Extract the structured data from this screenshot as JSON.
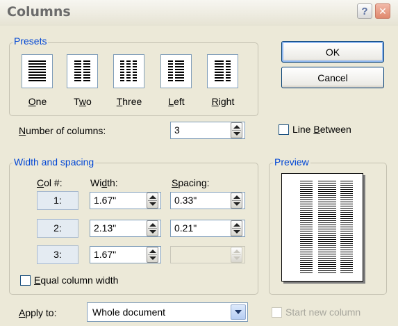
{
  "window": {
    "title": "Columns",
    "help_glyph": "?",
    "close_glyph": "✕"
  },
  "presets": {
    "legend": "Presets",
    "items": [
      {
        "label": "One",
        "key": "O",
        "rest": "ne",
        "icon": "one-column-icon"
      },
      {
        "label": "Two",
        "key": "w",
        "pre": "T",
        "rest": "o",
        "icon": "two-columns-icon"
      },
      {
        "label": "Three",
        "key": "T",
        "rest": "hree",
        "icon": "three-columns-icon"
      },
      {
        "label": "Left",
        "key": "L",
        "rest": "eft",
        "icon": "left-column-icon"
      },
      {
        "label": "Right",
        "key": "R",
        "rest": "ight",
        "icon": "right-column-icon"
      }
    ]
  },
  "buttons": {
    "ok": "OK",
    "cancel": "Cancel"
  },
  "number_of_columns": {
    "key": "N",
    "label_rest": "umber of columns:",
    "value": "3"
  },
  "line_between": {
    "key": "B",
    "pre": "Line ",
    "rest": "etween",
    "checked": false
  },
  "width_spacing": {
    "legend": "Width and spacing",
    "col_header": {
      "key": "C",
      "rest": "ol #:"
    },
    "width_header": {
      "pre": "Wi",
      "key": "d",
      "rest": "th:"
    },
    "spacing_header": {
      "key": "S",
      "rest": "pacing:"
    },
    "rows": [
      {
        "col": "1:",
        "width": "1.67\"",
        "spacing": "0.33\""
      },
      {
        "col": "2:",
        "width": "2.13\"",
        "spacing": "0.21\""
      },
      {
        "col": "3:",
        "width": "1.67\"",
        "spacing": ""
      }
    ]
  },
  "equal_width": {
    "key": "E",
    "rest": "qual column width",
    "checked": false
  },
  "preview": {
    "legend": "Preview"
  },
  "apply_to": {
    "key": "A",
    "rest": "pply to:",
    "value": "Whole document"
  },
  "start_new_column": {
    "label": "Start new column",
    "checked": false,
    "enabled": false
  },
  "colors": {
    "accent": "#0046d5",
    "face": "#ece9d8"
  }
}
